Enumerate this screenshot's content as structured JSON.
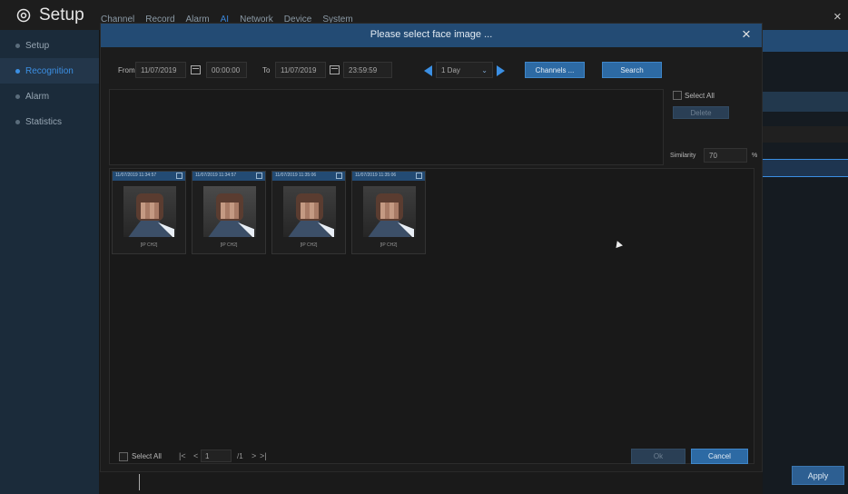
{
  "app": {
    "title": "Setup",
    "tabs": [
      "Channel",
      "Record",
      "Alarm",
      "AI",
      "Network",
      "Device",
      "System"
    ],
    "active_tab": "AI",
    "close_symbol": "×"
  },
  "sidebar": {
    "items": [
      {
        "label": "Setup",
        "active": false
      },
      {
        "label": "Recognition",
        "active": true
      },
      {
        "label": "Alarm",
        "active": false
      },
      {
        "label": "Statistics",
        "active": false
      }
    ]
  },
  "modal": {
    "title": "Please select face image ...",
    "close_symbol": "×",
    "search": {
      "from_label": "From",
      "from_date": "11/07/2019",
      "from_time": "00:00:00",
      "to_label": "To",
      "to_date": "11/07/2019",
      "to_time": "23:59:59",
      "range": "1 Day",
      "range_caret": "⌄",
      "channels_label": "Channels ...",
      "search_label": "Search"
    },
    "side": {
      "select_all_label": "Select All",
      "delete_label": "Delete",
      "similarity_label": "Similarity",
      "similarity_value": "70",
      "similarity_unit": "%"
    },
    "results": [
      {
        "time": "11/07/2019 11:34:57",
        "channel": "[IP CH2]"
      },
      {
        "time": "11/07/2019 11:34:57",
        "channel": "[IP CH2]"
      },
      {
        "time": "11/07/2019 11:35:06",
        "channel": "[IP CH2]"
      },
      {
        "time": "11/07/2019 11:35:06",
        "channel": "[IP CH2]"
      }
    ],
    "footer": {
      "select_all_label": "Select All",
      "first_page": "|<",
      "prev_page": "<",
      "page_current": "1",
      "page_total": "/1",
      "next_page": ">",
      "last_page": ">|",
      "ok_label": "Ok",
      "cancel_label": "Cancel"
    }
  },
  "background": {
    "apply_label": "Apply"
  },
  "colors": {
    "accent": "#3b8fe3",
    "header_blue": "#234b74",
    "button_blue": "#2d6aa4",
    "sidebar_bg": "#1b2b3a"
  }
}
